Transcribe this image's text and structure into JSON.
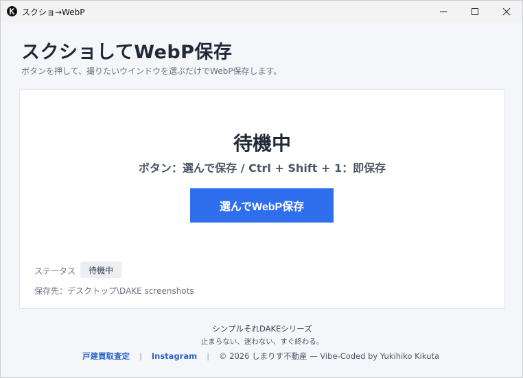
{
  "window": {
    "title": "スクショ→WebP"
  },
  "header": {
    "title": "スクショしてWebP保存",
    "subtitle": "ボタンを押して、撮りたいウインドウを選ぶだけでWebP保存します。"
  },
  "card": {
    "state_title": "待機中",
    "state_description": "ボタン：選んで保存 / Ctrl + Shift + 1：即保存",
    "capture_button_label": "選んでWebP保存",
    "status_label": "ステータス",
    "status_value": "待機中",
    "save_path": "保存先：デスクトップ\\DAKE screenshots"
  },
  "footer": {
    "series": "シンプルそれDAKEシリーズ",
    "tagline": "止まらない、迷わない、すぐ終わる。",
    "link_1": "戸建買取査定",
    "separator": "|",
    "link_2": "Instagram",
    "copyright": "© 2026 しまりす不動産 — Vibe-Coded by Yukihiko Kikuta"
  },
  "colors": {
    "accent": "#2f6fed",
    "link": "#2a63c9",
    "background": "#f4f6f9",
    "card": "#ffffff"
  },
  "icons": {
    "app": "app-logo-icon",
    "minimize": "minimize-icon",
    "maximize": "maximize-icon",
    "close": "close-icon"
  }
}
